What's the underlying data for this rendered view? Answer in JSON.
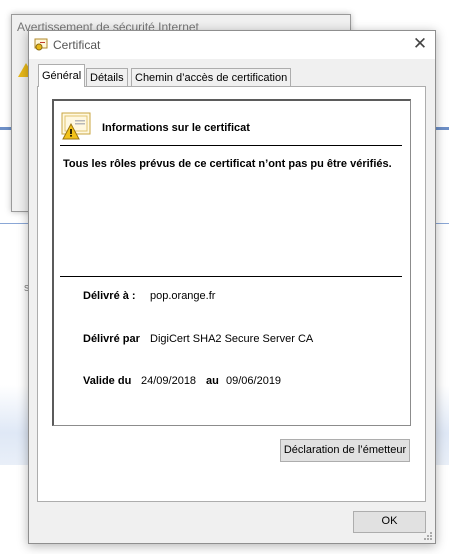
{
  "background": {
    "warning_window_title": "Avertissement de sécurité Internet",
    "stray_char": "s"
  },
  "dialog": {
    "title": "Certificat",
    "close_glyph": "✕",
    "tabs": [
      {
        "label": "Général",
        "active": true
      },
      {
        "label": "Détails",
        "active": false
      },
      {
        "label": "Chemin d’accès de certification",
        "active": false
      }
    ],
    "info_heading": "Informations sur le certificat",
    "warning": "Tous les rôles prévus de ce certificat n’ont pas pu être vérifiés.",
    "issued_to_label": "Délivré à :",
    "issued_to_value": "pop.orange.fr",
    "issued_by_label": "Délivré par",
    "issued_by_value": "DigiCert SHA2 Secure Server CA",
    "valid_from_label": "Valide du",
    "valid_from_value": "24/09/2018",
    "valid_to_label": "au",
    "valid_to_value": "09/06/2019",
    "issuer_statement_button": "Déclaration de l’émetteur",
    "ok_button": "OK"
  },
  "icons": {
    "title": "certificate-icon",
    "info": "certificate-warning-icon",
    "close": "close-icon"
  },
  "colors": {
    "warning_yellow": "#e8b818",
    "dialog_bg": "#f0f0f0",
    "button_bg": "#e1e1e1"
  }
}
